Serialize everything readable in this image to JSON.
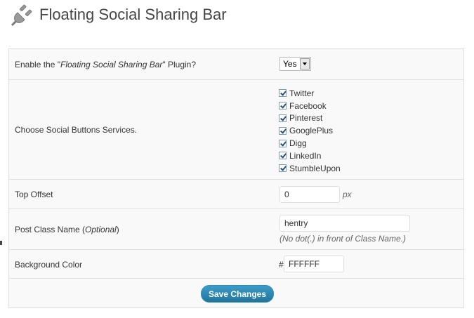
{
  "page": {
    "title": "Floating Social Sharing Bar",
    "icon": "plugin-plug-icon"
  },
  "settings": {
    "enable": {
      "label_prefix": "Enable the \"",
      "label_plugin": "Floating Social Sharing Bar",
      "label_suffix": "\" Plugin?",
      "selected": "Yes"
    },
    "services": {
      "label": "Choose Social Buttons Services.",
      "items": [
        {
          "label": "Twitter",
          "checked": true
        },
        {
          "label": "Facebook",
          "checked": true
        },
        {
          "label": "Pinterest",
          "checked": true
        },
        {
          "label": "GooglePlus",
          "checked": true
        },
        {
          "label": "Digg",
          "checked": true
        },
        {
          "label": "LinkedIn",
          "checked": true
        },
        {
          "label": "StumbleUpon",
          "checked": true
        }
      ]
    },
    "top_offset": {
      "label": "Top Offset",
      "value": "0",
      "unit": "px"
    },
    "post_class": {
      "label_main": "Post Class Name (",
      "label_optional": "Optional",
      "label_close": ")",
      "value": "hentry",
      "help": "(No dot(.) in front of Class Name.)"
    },
    "background": {
      "label": "Background Color",
      "prefix": "#",
      "value": "FFFFFF"
    }
  },
  "actions": {
    "save_label": "Save Changes"
  },
  "colors": {
    "button": "#21759b",
    "panel_bg": "#f9f9f9",
    "border": "#dfdfdf"
  }
}
